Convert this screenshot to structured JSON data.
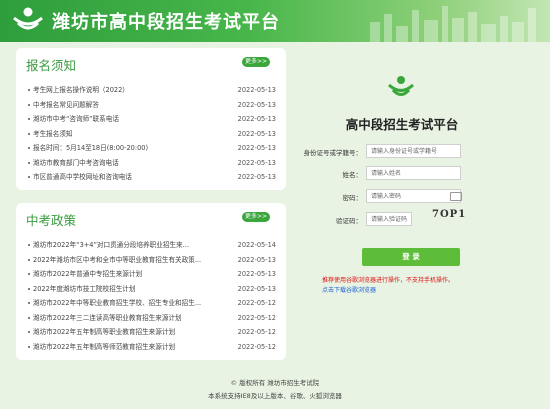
{
  "header": {
    "title": "潍坊市高中段招生考试平台"
  },
  "notice": {
    "title": "报名须知",
    "more_label": "更多>>",
    "items": [
      {
        "text": "考生网上报名操作说明（2022）",
        "date": "2022-05-13"
      },
      {
        "text": "中考报名常见问题解答",
        "date": "2022-05-13"
      },
      {
        "text": "潍坊市中考“咨询师”联系电话",
        "date": "2022-05-13"
      },
      {
        "text": "考生报名须知",
        "date": "2022-05-13"
      },
      {
        "text": "报名时间：5月14至18日(8:00-20:00)",
        "date": "2022-05-13"
      },
      {
        "text": "潍坊市教育部门中考咨询电话",
        "date": "2022-05-13"
      },
      {
        "text": "市区普通高中学校网址和咨询电话",
        "date": "2022-05-13"
      }
    ]
  },
  "policy": {
    "title": "中考政策",
    "more_label": "更多>>",
    "items": [
      {
        "text": "潍坊市2022年“3+4”对口贯通分段培养职业招生来...",
        "date": "2022-05-14"
      },
      {
        "text": "2022年潍坊市区中考和全市中等职业教育招生有关政策...",
        "date": "2022-05-13"
      },
      {
        "text": "潍坊市2022年普通中专招生来源计划",
        "date": "2022-05-13"
      },
      {
        "text": "2022年度潍坊市技工院校招生计划",
        "date": "2022-05-13"
      },
      {
        "text": "潍坊市2022年中等职业教育招生学校、招生专业和招生...",
        "date": "2022-05-12"
      },
      {
        "text": "潍坊市2022年三二连读高等职业教育招生来源计划",
        "date": "2022-05-12"
      },
      {
        "text": "潍坊市2022年五年制高等职业教育招生来源计划",
        "date": "2022-05-12"
      },
      {
        "text": "潍坊市2022年五年制高等师范教育招生来源计划",
        "date": "2022-05-12"
      }
    ]
  },
  "login": {
    "title": "高中段招生考试平台",
    "id_label": "身份证号或学籍号：",
    "id_placeholder": "请输入身份证号或学籍号",
    "name_label": "姓名：",
    "name_placeholder": "请输入姓名",
    "pwd_label": "密码：",
    "pwd_placeholder": "请输入密码",
    "captcha_label": "验证码：",
    "captcha_placeholder": "请输入验证码",
    "captcha_text": "7OP1",
    "button_label": "登 录",
    "tip1": "推荐使用谷歌浏览器进行操作，不支持手机操作。",
    "tip2": "点击下载谷歌浏览器"
  },
  "footer": {
    "copyright": "© 版权所有 潍坊市招生考试院",
    "support": "本系统支持IE8及以上版本、谷歌、火狐浏览器"
  },
  "colors": {
    "brand": "#3aa63b",
    "page_bg": "#e9f3e3",
    "tip_red": "#dd1111",
    "link_blue": "#1c5fd1"
  }
}
